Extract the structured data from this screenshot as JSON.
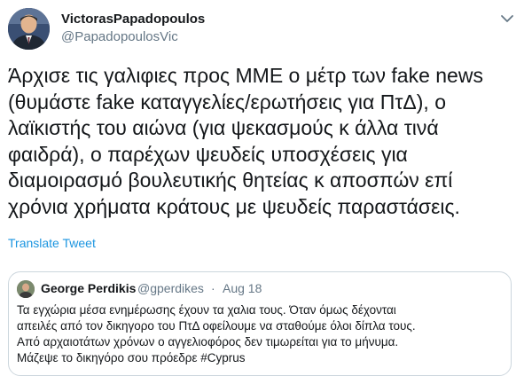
{
  "author": {
    "display_name": "VictorasPapadopoulos",
    "handle": "@PapadopoulosVic"
  },
  "icons": {
    "avatar": "profile-photo",
    "more": "chevron-down-icon"
  },
  "tweet": {
    "text_lines": [
      "Άρχισε τις γαλιφιες προς ΜΜΕ ο μέτρ των fake news",
      "(θυμάστε fake καταγγελίες/ερωτήσεις για ΠτΔ), ο",
      "λαϊκιστής του αιώνα (για ψεκασμούς κ άλλα τινά",
      "φαιδρά), ο παρέχων ψευδείς υποσχέσεις για",
      "διαμοιρασμό βουλευτικής θητείας κ αποσπών επί",
      "χρόνια χρήματα κράτους με ψευδείς  παραστάσεις."
    ],
    "translate_label": "Translate Tweet"
  },
  "quoted": {
    "display_name": "George Perdikis",
    "handle": "@gperdikes",
    "separator": "·",
    "date": "Aug 18",
    "text_lines": [
      "Τα εγχώρια μέσα ενημέρωσης έχουν τα χαλια τους. Όταν όμως δέχονται",
      "απειλές από τον δικηγορο του ΠτΔ οφείλουμε να σταθούμε όλοι δίπλα τους.",
      "Από αρχαιοτάτων χρόνων ο αγγελιοφόρος δεν τιμωρείται για το μήνυμα.",
      "Μάζεψε το δικηγόρο σου πρόεδρε #Cyprus"
    ]
  },
  "colors": {
    "text": "#14171a",
    "secondary": "#657786",
    "link": "#1b95e0",
    "border": "#ccd6dd"
  }
}
